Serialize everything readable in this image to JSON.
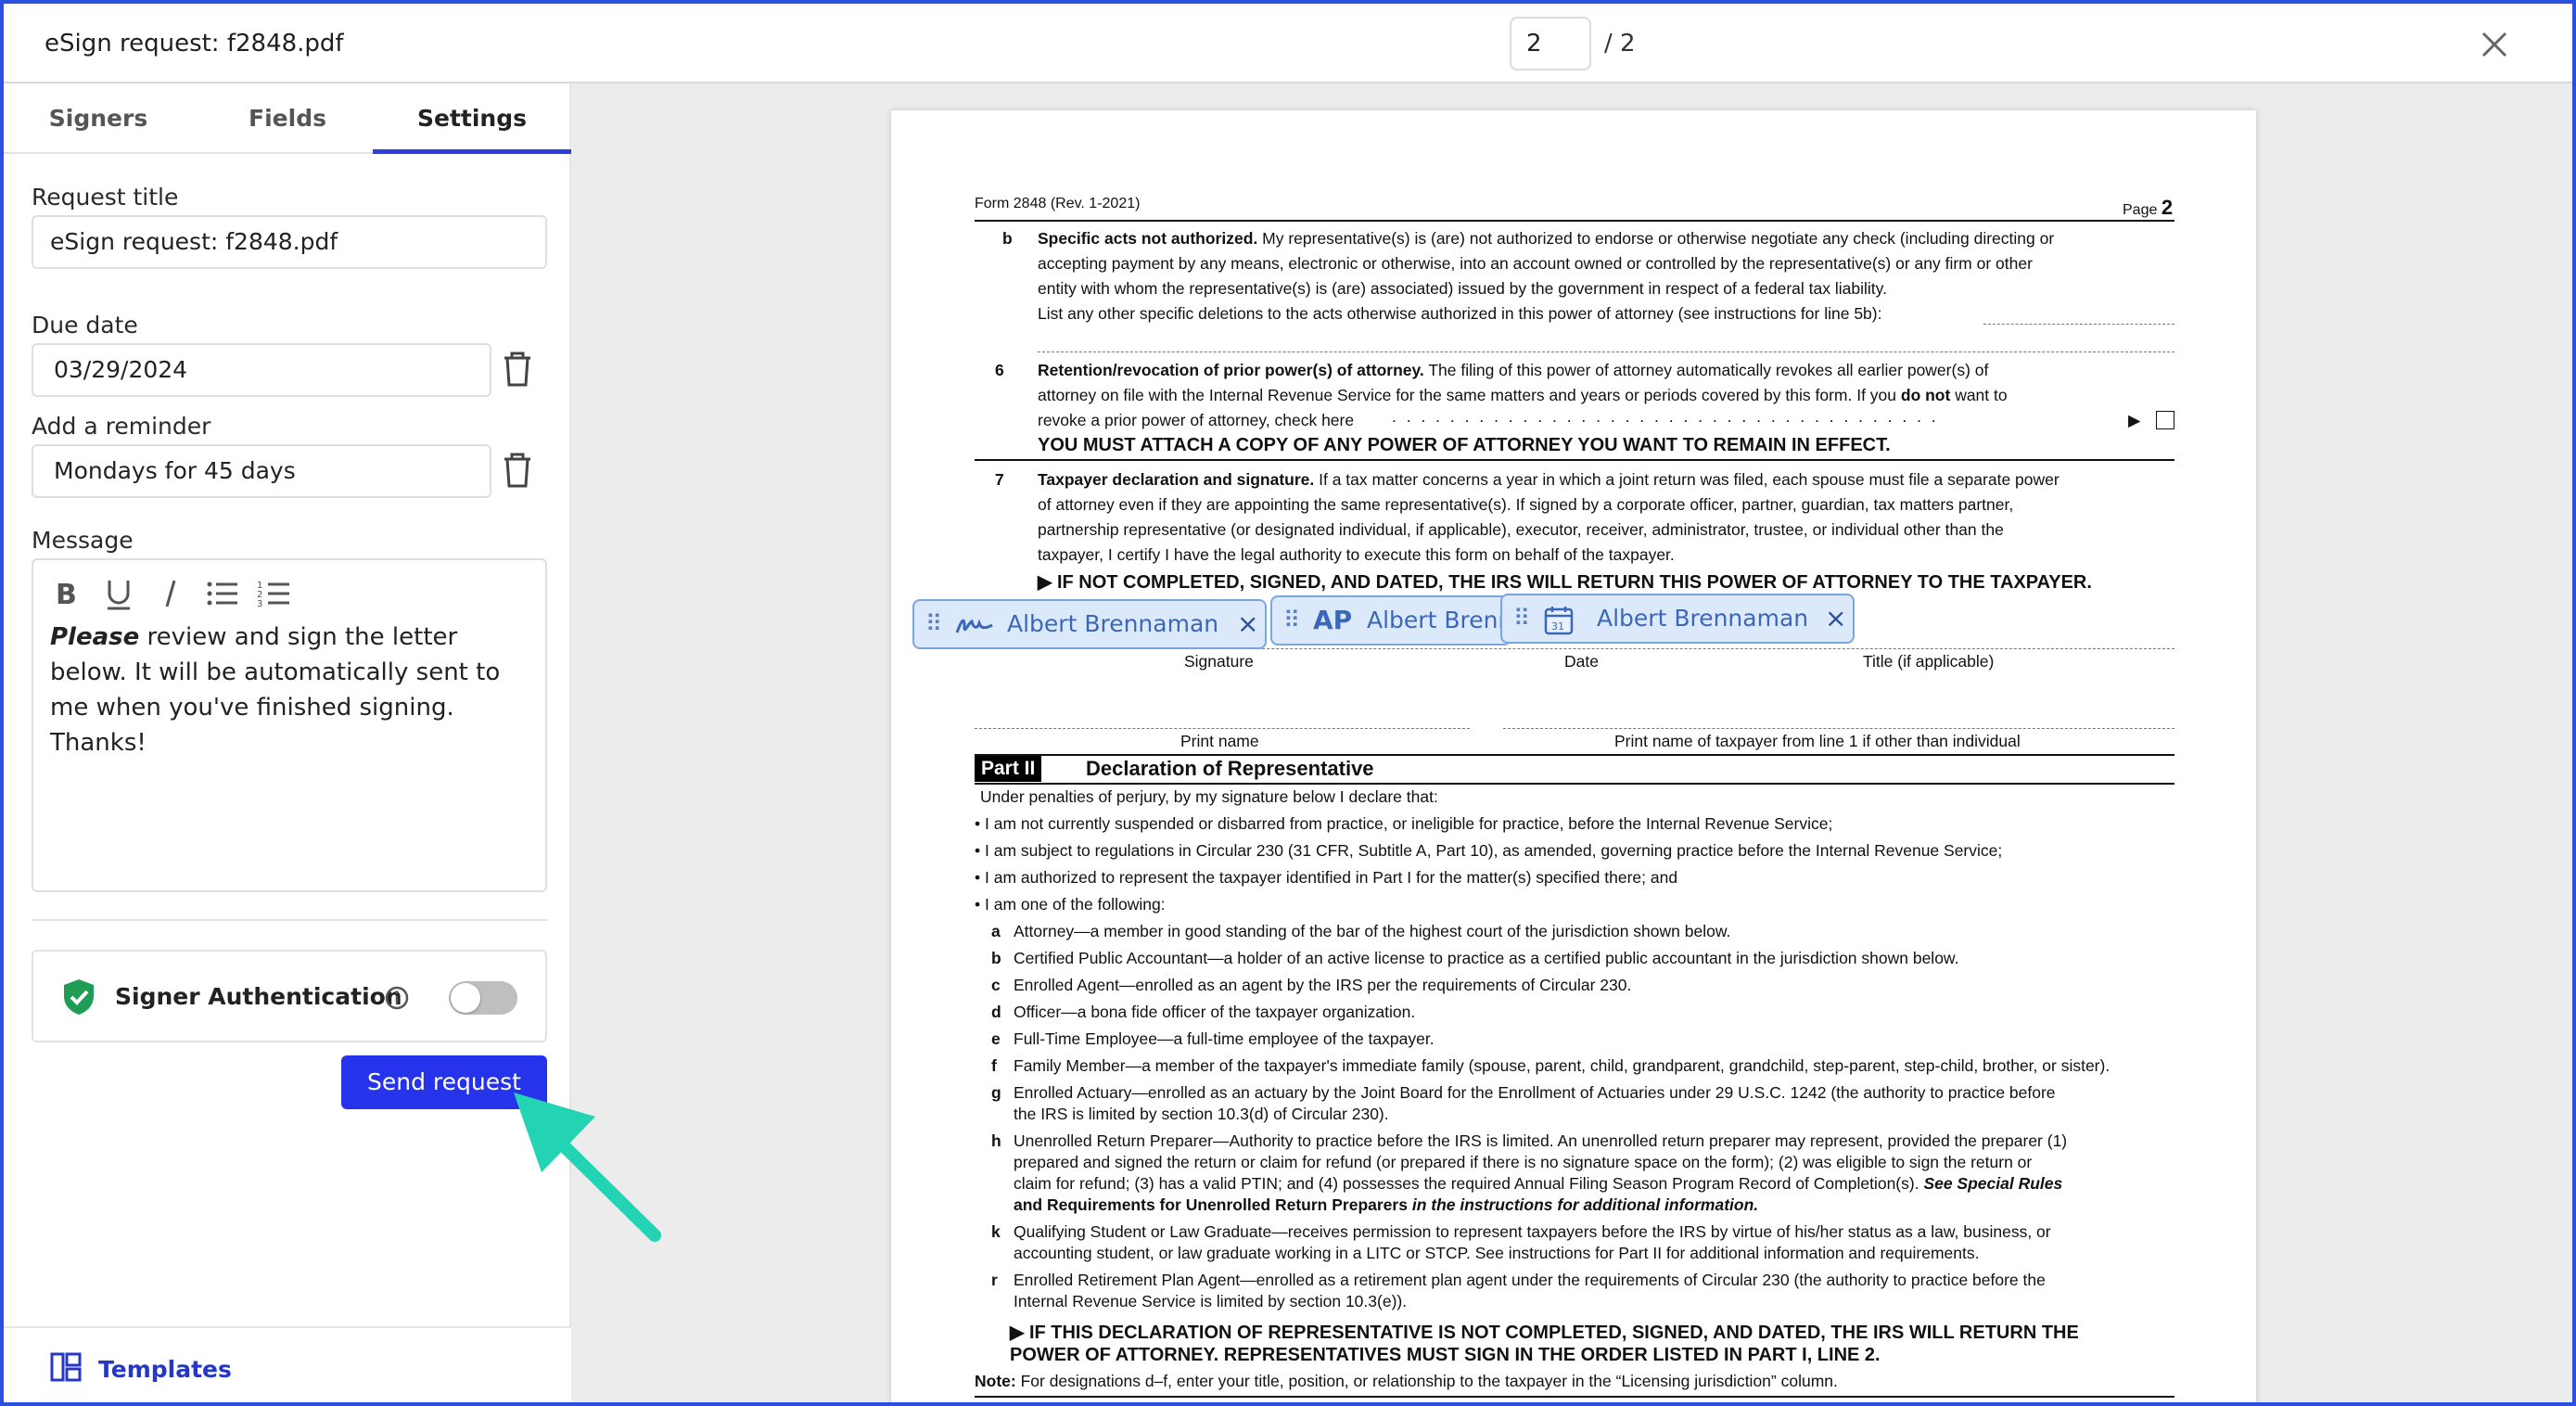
{
  "header": {
    "title": "eSign request: f2848.pdf",
    "page_current": "2",
    "page_total": "/ 2"
  },
  "tabs": [
    "Signers",
    "Fields",
    "Settings"
  ],
  "settings": {
    "request_title_label": "Request title",
    "request_title_value": "eSign request: f2848.pdf",
    "due_date_label": "Due date",
    "due_date_value": "03/29/2024",
    "reminder_label": "Add a reminder",
    "reminder_value": "Mondays for 45 days",
    "message_label": "Message",
    "message_bold": "Please",
    "message_rest": " review and sign the letter below. It will be automatically sent to me when you've finished signing. Thanks!",
    "signer_auth_label": "Signer Authentication",
    "signer_auth_enabled": false,
    "send_label": "Send request",
    "templates_label": "Templates"
  },
  "fields": {
    "signature_chip": "Albert Brennaman",
    "initials_chip": "Albert Brennaman",
    "initials_prefix": "AP",
    "date_chip": "Albert Brennaman",
    "date_icon_text": "31"
  },
  "document": {
    "form_id": "Form 2848 (Rev. 1-2021)",
    "page_label": "Page",
    "page_num": "2",
    "b_letter": "b",
    "b_title": "Specific acts not authorized.",
    "b_line1": " My representative(s) is (are) not authorized to endorse or otherwise negotiate any check (including directing or",
    "b_line2": "accepting payment by any means, electronic or otherwise, into an account owned or controlled by the representative(s) or any firm or other",
    "b_line3": "entity with whom the representative(s) is (are) associated) issued by the government in respect of a federal tax liability.",
    "b_line4": "List any other specific deletions to the acts otherwise authorized in this power of attorney (see instructions for line 5b):",
    "s6_num": "6",
    "s6_title": "Retention/revocation of prior power(s) of attorney.",
    "s6_line1": " The filing of this power of attorney automatically revokes all earlier power(s) of",
    "s6_line2a": "attorney on file with the Internal Revenue Service for the same matters and years or periods covered by this form. If you ",
    "s6_line2b": "do not",
    "s6_line2c": " want to",
    "s6_line3": "revoke a prior power of attorney, check here",
    "s6_dots": ". . . . . . . . . . . . . . . . . . . . . . . . . . . . . . . . . . . . . .",
    "s6_arrow": "▶",
    "s6_attach": "YOU MUST ATTACH A COPY OF ANY POWER OF ATTORNEY YOU WANT TO REMAIN IN EFFECT.",
    "s7_num": "7",
    "s7_title": "Taxpayer declaration and signature.",
    "s7_line1": " If a tax matter concerns a year in which a joint return was filed, each spouse must file a separate power",
    "s7_line2": "of attorney even if they are appointing the same representative(s). If signed by a corporate officer, partner, guardian, tax matters partner,",
    "s7_line3": "partnership representative (or designated individual, if applicable), executor, receiver, administrator, trustee, or individual other than the",
    "s7_line4": "taxpayer, I certify I have the legal authority to execute this form on behalf of the taxpayer.",
    "s7_warning": "▶ IF NOT COMPLETED, SIGNED, AND DATED, THE IRS WILL RETURN THIS POWER OF ATTORNEY TO THE TAXPAYER.",
    "sig_label": "Signature",
    "date_label": "Date",
    "title_label": "Title (if applicable)",
    "print_name_label": "Print name",
    "print_name_taxpayer_label": "Print name of taxpayer from line 1 if other than individual",
    "part2_tag": "Part II",
    "part2_title": "Declaration of Representative",
    "p2_intro": "Under penalties of perjury, by my signature below I declare that:",
    "p2_b1": "• I am not currently suspended or disbarred from practice, or ineligible for practice, before the Internal Revenue Service;",
    "p2_b2": "• I am subject to regulations in Circular 230 (31 CFR, Subtitle A, Part 10), as amended, governing practice before the Internal Revenue Service;",
    "p2_b3": "• I am authorized to represent the taxpayer identified in Part I for the matter(s) specified there; and",
    "p2_b4": "• I am one of the following:",
    "items": [
      {
        "k": "a",
        "t": "Attorney—a member in good standing of the bar of the highest court of the jurisdiction shown below."
      },
      {
        "k": "b",
        "t": "Certified Public Accountant—a holder of an active license to practice as a certified public accountant in the jurisdiction shown below."
      },
      {
        "k": "c",
        "t": "Enrolled Agent—enrolled as an agent by the IRS per the requirements of Circular 230."
      },
      {
        "k": "d",
        "t": "Officer—a bona fide officer of the taxpayer organization."
      },
      {
        "k": "e",
        "t": "Full-Time Employee—a full-time employee of the taxpayer."
      },
      {
        "k": "f",
        "t": "Family Member—a member of the taxpayer's immediate family (spouse, parent, child, grandparent, grandchild, step-parent, step-child, brother, or sister)."
      }
    ],
    "g_key": "g",
    "g_line1": "Enrolled Actuary—enrolled as an actuary by the Joint Board for the Enrollment of Actuaries under 29 U.S.C. 1242 (the authority to practice before",
    "g_line2": "the IRS is limited by section 10.3(d) of Circular 230).",
    "h_key": "h",
    "h_line1": "Unenrolled Return Preparer—Authority to practice before the IRS is limited. An unenrolled return preparer may represent, provided the preparer (1)",
    "h_line2": "prepared and signed the return or claim for refund (or prepared if there is no signature space on the form); (2) was eligible to sign the return or",
    "h_line3a": "claim for refund; (3) has a valid PTIN; and (4) possesses the required Annual Filing Season Program Record of Completion(s). ",
    "h_line3b": "See Special Rules",
    "h_line4a": "and Requirements for Unenrolled Return Preparers",
    "h_line4b": " in the instructions for additional information.",
    "k_key": "k",
    "k_line1": "Qualifying Student or Law Graduate—receives permission to represent taxpayers before the IRS by virtue of his/her status as a law, business, or",
    "k_line2": "accounting student, or law graduate working in a LITC or STCP. See instructions for Part II for additional information and requirements.",
    "r_key": "r",
    "r_line1": "Enrolled Retirement Plan Agent—enrolled as a retirement plan agent under the requirements of Circular 230 (the authority to practice before the",
    "r_line2": "Internal Revenue Service is limited by section 10.3(e)).",
    "final_warning1": "▶ IF THIS DECLARATION OF REPRESENTATIVE IS NOT COMPLETED, SIGNED, AND DATED, THE IRS WILL RETURN THE",
    "final_warning2": "POWER OF ATTORNEY. REPRESENTATIVES MUST SIGN IN THE ORDER LISTED IN PART I, LINE 2.",
    "note_label": "Note:",
    "note_text": " For designations d–f, enter your title, position, or relationship to the taxpayer in the “Licensing jurisdiction” column."
  },
  "colors": {
    "accent": "#2533ea",
    "tab_underline": "#2d3fe0",
    "chip_bg": "#dce9fb",
    "chip_border": "#7aa6e0",
    "shield_green": "#1f9d55",
    "arrow_teal": "#22d3b4"
  }
}
